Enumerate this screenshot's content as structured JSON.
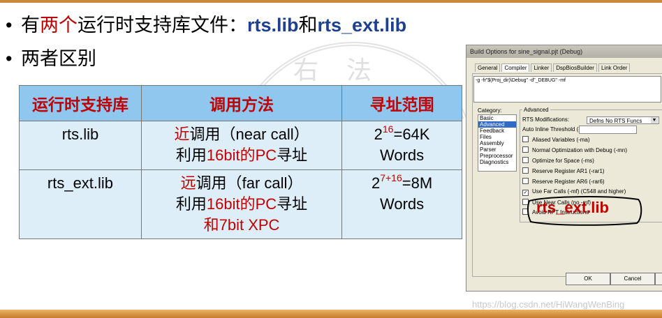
{
  "bullets": {
    "b1_pre": "有",
    "b1_red": "两个",
    "b1_mid": "运行时支持库文件：",
    "b1_lib1": "rts.lib",
    "b1_and": "和",
    "b1_lib2": "rts_ext.lib",
    "b2": "两者区别",
    "dot": "•"
  },
  "seal_text": "右法 春天",
  "table": {
    "headers": [
      "运行时支持库",
      "调用方法",
      "寻址范围"
    ],
    "rows": [
      {
        "lib": "rts.lib",
        "call_red": "近",
        "call_rest": "调用（near call）",
        "line2_pre": "利用",
        "line2_red": "16bit的PC",
        "line2_post": "寻址",
        "line3": "",
        "range_base": "2",
        "range_exp": "16",
        "range_rest": "=64K",
        "range_unit": "Words"
      },
      {
        "lib": "rts_ext.lib",
        "call_red": "远",
        "call_rest": "调用（far call）",
        "line2_pre": "利用",
        "line2_red": "16bit的PC",
        "line2_post": "寻址",
        "line3": "和7bit XPC",
        "range_base": "2",
        "range_exp": "7+16",
        "range_rest": "=8M",
        "range_unit": "Words"
      }
    ]
  },
  "dialog": {
    "title": "Build Options for sine_signal.pjt (Debug)",
    "tabs": [
      "General",
      "Compiler",
      "Linker",
      "DspBiosBuilder",
      "Link Order"
    ],
    "active_tab": "Compiler",
    "cmdline": "-g -fr\"$(Proj_dir)\\Debug\" -d\"_DEBUG\" -mf",
    "category_label": "Category:",
    "categories": [
      "Basic",
      "Advanced",
      "Feedback",
      "Files",
      "Assembly",
      "Parser",
      "Preprocessor",
      "Diagnostics"
    ],
    "selected_category": "Advanced",
    "group_label": "Advanced",
    "rts_mod_label": "RTS Modifications:",
    "rts_mod_value": "Defns No RTS Funcs",
    "inline_label": "Auto Inline Threshold (-oi):",
    "options": [
      {
        "label": "Aliased Variables (-ma)",
        "checked": false
      },
      {
        "label": "Normal Optimization with Debug (-mn)",
        "checked": false
      },
      {
        "label": "Optimize for Space (-ms)",
        "checked": false
      },
      {
        "label": "Reserve Register AR1 (-rar1)",
        "checked": false
      },
      {
        "label": "Reserve Register AR6 (-rar6)",
        "checked": false
      },
      {
        "label": "Use Far Calls (-mf) (C548 and higher)",
        "checked": true
      },
      {
        "label": "Use Near Calls (no -mf)",
        "checked": false
      },
      {
        "label": "Avoid RPT Instructions",
        "checked": false
      }
    ],
    "ok": "OK",
    "cancel": "Cancel"
  },
  "annotation": "rts_ext.lib",
  "watermark": "https://blog.csdn.net/HiWangWenBing"
}
